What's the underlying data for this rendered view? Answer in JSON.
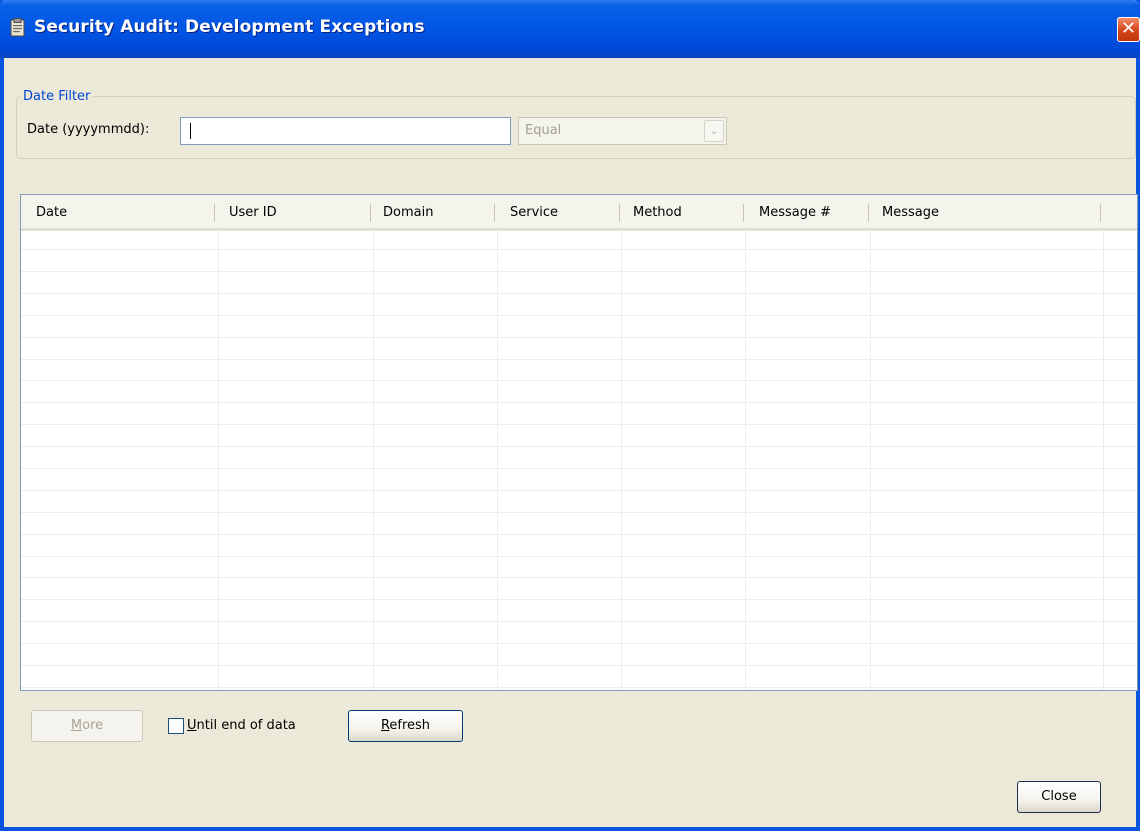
{
  "window": {
    "title": "Security Audit: Development Exceptions",
    "close_glyph": "✕",
    "accent_color": "#0055E5"
  },
  "date_filter": {
    "legend": "Date Filter",
    "date_label": "Date (yyyymmdd):",
    "date_value": "",
    "operator": "Equal",
    "operator_arrow": "⌄"
  },
  "table": {
    "columns": [
      "Date",
      "User ID",
      "Domain",
      "Service",
      "Method",
      "Message #",
      "Message"
    ],
    "rows": []
  },
  "actions": {
    "more": {
      "mnemonic": "M",
      "rest": "ore"
    },
    "until_end": {
      "mnemonic": "U",
      "rest": "ntil end of data",
      "checked": false
    },
    "refresh": {
      "mnemonic": "R",
      "rest": "efresh"
    },
    "close": "Close"
  }
}
